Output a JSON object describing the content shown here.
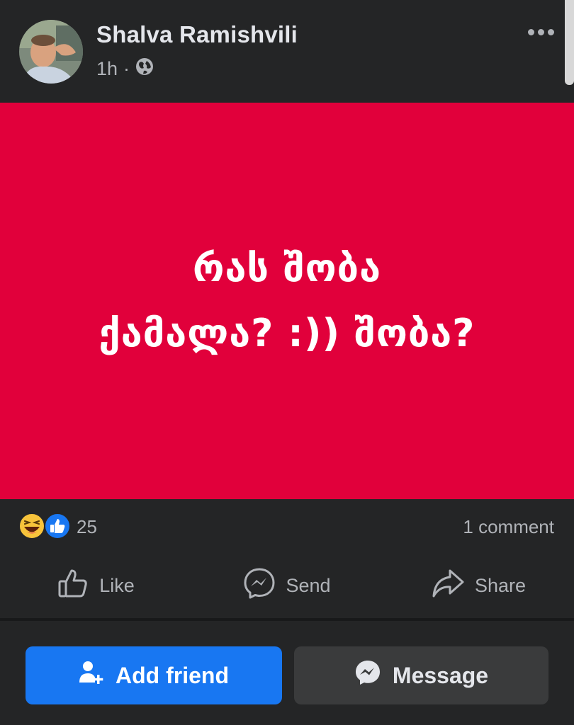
{
  "post": {
    "author": "Shalva Ramishvili",
    "time": "1h",
    "separator": "·",
    "privacy_icon": "globe-icon",
    "text_line1": "რას შობა",
    "text_line2": "ქამალა? :)) შობა?",
    "background_color": "#e1003b"
  },
  "reactions": {
    "icons": [
      "haha-emoji-icon",
      "like-reaction-icon"
    ],
    "count": "25",
    "comments": "1 comment"
  },
  "actions": {
    "like": "Like",
    "send": "Send",
    "share": "Share"
  },
  "buttons": {
    "add_friend": "Add friend",
    "message": "Message"
  },
  "colors": {
    "background": "#242526",
    "accent": "#1877f2",
    "secondary_button": "#3a3b3c",
    "muted_text": "#b0b3b8"
  }
}
